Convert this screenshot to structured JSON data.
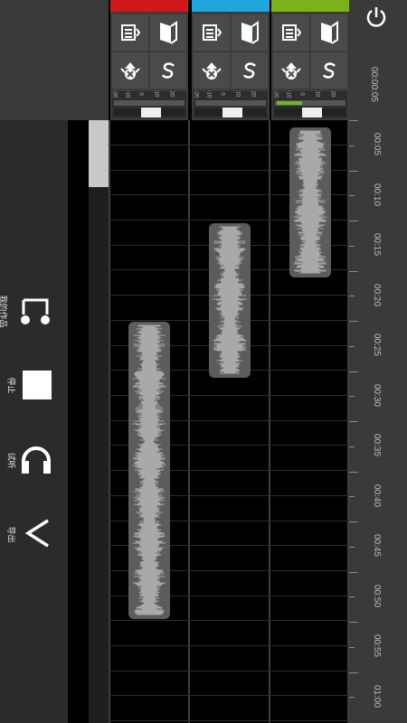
{
  "tracks": [
    {
      "color": "#d21919"
    },
    {
      "color": "#1fa7dc"
    },
    {
      "color": "#7bb21a"
    }
  ],
  "meter": {
    "scale": [
      "-20",
      "-10",
      "0",
      "10",
      "20"
    ]
  },
  "ruler": {
    "header_time": "00:00:05",
    "ticks": [
      "00:05",
      "00:10",
      "00:15",
      "00:20",
      "00:25",
      "00:30",
      "00:35",
      "00:40",
      "00:45",
      "00:50",
      "00:55",
      "01:00"
    ]
  },
  "sidebar": {
    "items": [
      {
        "label": "我的作品",
        "icon": "music-note-icon"
      },
      {
        "label": "停止",
        "icon": "stop-icon"
      },
      {
        "label": "试听",
        "icon": "headphones-icon"
      },
      {
        "label": "导出",
        "icon": "chevron-left-icon"
      }
    ]
  },
  "power_icon": "power-icon"
}
